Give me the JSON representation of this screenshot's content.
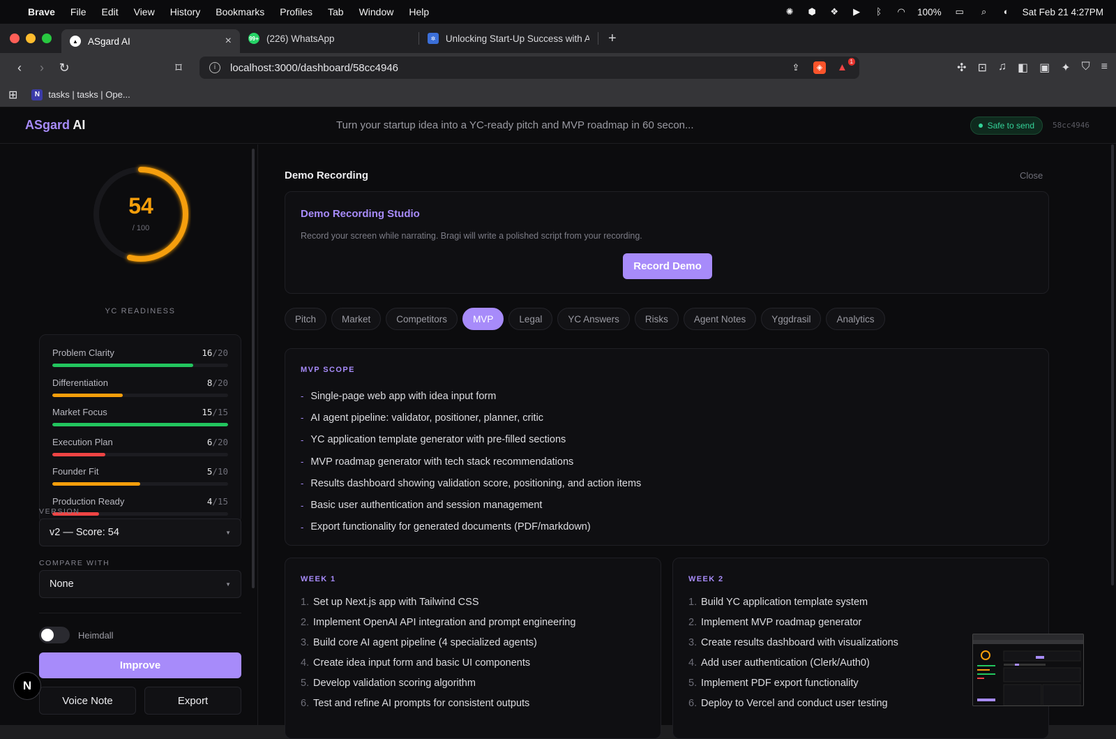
{
  "menubar": {
    "app": "Brave",
    "items": [
      "File",
      "Edit",
      "View",
      "History",
      "Bookmarks",
      "Profiles",
      "Tab",
      "Window",
      "Help"
    ],
    "battery": "100%",
    "datetime": "Sat Feb 21  4:27PM"
  },
  "browser": {
    "tabs": [
      {
        "title": "ASgard AI",
        "favicon": "triangle-icon"
      },
      {
        "title": "(226) WhatsApp",
        "favicon": "whatsapp-icon",
        "badge": "99+"
      },
      {
        "title": "Unlocking Start-Up Success with A",
        "favicon": "gear-icon"
      }
    ],
    "url": "localhost:3000/dashboard/58cc4946",
    "bat_badge": "1",
    "bookmark": "tasks | tasks | Ope..."
  },
  "app": {
    "logo_part1": "ASgard",
    "logo_part2": "AI",
    "tagline": "Turn your startup idea into a YC-ready pitch and MVP roadmap in 60 secon...",
    "status": "Safe to send",
    "id": "58cc4946"
  },
  "sidebar": {
    "score": "54",
    "score_max": "/ 100",
    "score_fraction": 0.54,
    "score_label": "YC READINESS",
    "metrics": [
      {
        "label": "Problem Clarity",
        "value": "16",
        "max": "/20",
        "fraction": 0.8,
        "color": "#22c55e"
      },
      {
        "label": "Differentiation",
        "value": "8",
        "max": "/20",
        "fraction": 0.4,
        "color": "#f59e0b"
      },
      {
        "label": "Market Focus",
        "value": "15",
        "max": "/15",
        "fraction": 1.0,
        "color": "#22c55e"
      },
      {
        "label": "Execution Plan",
        "value": "6",
        "max": "/20",
        "fraction": 0.3,
        "color": "#ef4444"
      },
      {
        "label": "Founder Fit",
        "value": "5",
        "max": "/10",
        "fraction": 0.5,
        "color": "#f59e0b"
      },
      {
        "label": "Production Ready",
        "value": "4",
        "max": "/15",
        "fraction": 0.267,
        "color": "#ef4444"
      }
    ],
    "version_label": "VERSION",
    "version_value": "v2 — Score: 54",
    "compare_label": "COMPARE WITH",
    "compare_value": "None",
    "toggle_label": "Heimdall",
    "improve": "Improve",
    "voice_note": "Voice Note",
    "export": "Export"
  },
  "main": {
    "demo_title": "Demo Recording",
    "close": "Close",
    "studio_title": "Demo Recording Studio",
    "studio_desc": "Record your screen while narrating. Bragi will write a polished script from your recording.",
    "record_button": "Record Demo",
    "tabs": [
      "Pitch",
      "Market",
      "Competitors",
      "MVP",
      "Legal",
      "YC Answers",
      "Risks",
      "Agent Notes",
      "Yggdrasil",
      "Analytics"
    ],
    "active_tab": "MVP",
    "scope_label": "MVP SCOPE",
    "scope_items": [
      "Single-page web app with idea input form",
      "AI agent pipeline: validator, positioner, planner, critic",
      "YC application template generator with pre-filled sections",
      "MVP roadmap generator with tech stack recommendations",
      "Results dashboard showing validation score, positioning, and action items",
      "Basic user authentication and session management",
      "Export functionality for generated documents (PDF/markdown)"
    ],
    "week1_label": "WEEK 1",
    "week1_items": [
      "Set up Next.js app with Tailwind CSS",
      "Implement OpenAI API integration and prompt engineering",
      "Build core AI agent pipeline (4 specialized agents)",
      "Create idea input form and basic UI components",
      "Develop validation scoring algorithm",
      "Test and refine AI prompts for consistent outputs"
    ],
    "week2_label": "WEEK 2",
    "week2_items": [
      "Build YC application template system",
      "Implement MVP roadmap generator",
      "Create results dashboard with visualizations",
      "Add user authentication (Clerk/Auth0)",
      "Implement PDF export functionality",
      "Deploy to Vercel and conduct user testing"
    ]
  },
  "accent": "#a78bfa",
  "n_button": "N"
}
